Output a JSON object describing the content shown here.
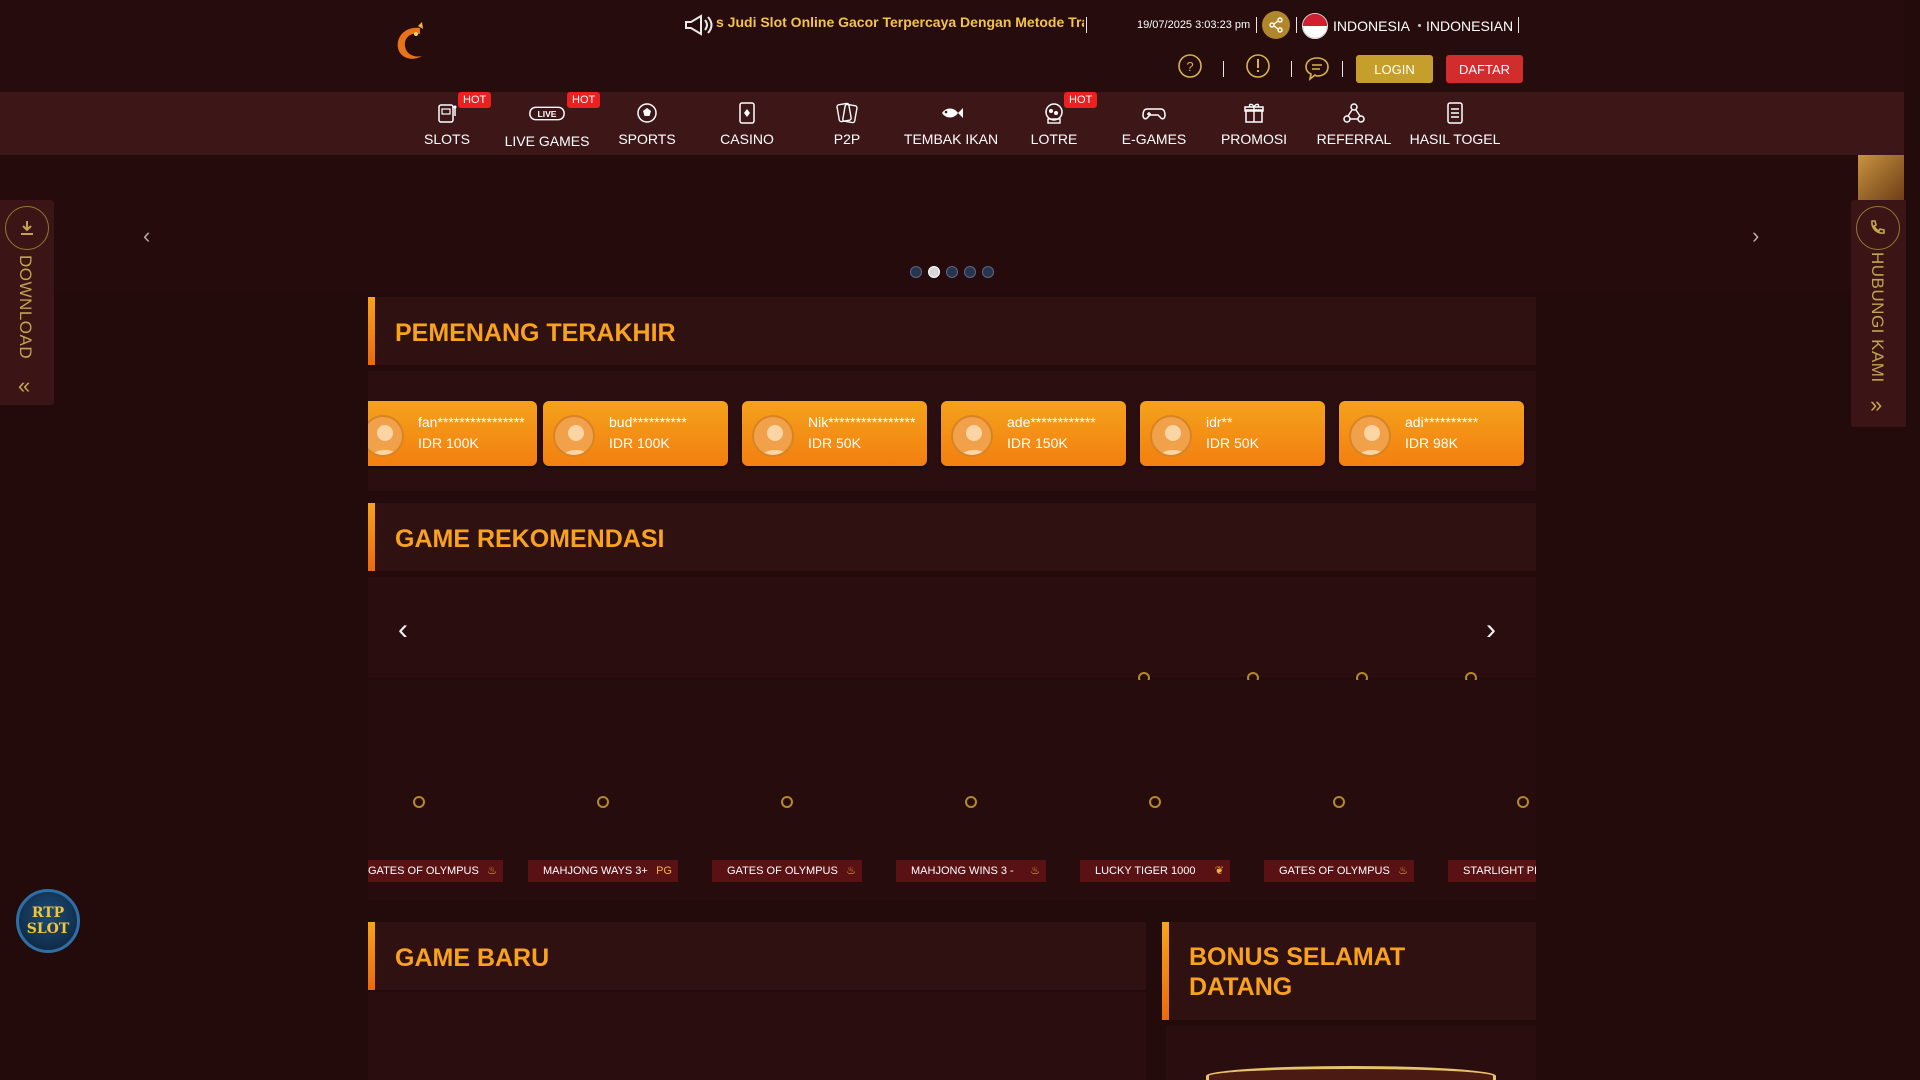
{
  "header": {
    "marquee_text": "s  Judi Slot Online Gacor Terpercaya Dengan Metode Transaksi",
    "datetime": "19/07/2025 3:03:23 pm",
    "country": "INDONESIA",
    "language": "INDONESIAN",
    "login_label": "LOGIN",
    "register_label": "DAFTAR",
    "colors": {
      "login": "#c59e2c",
      "register": "#d22c2c",
      "accent": "#f9a21e"
    }
  },
  "nav": {
    "items": [
      {
        "label": "SLOTS",
        "icon": "slot-machine-icon",
        "badge": "HOT"
      },
      {
        "label": "LIVE GAMES",
        "icon": "live-icon",
        "badge": "HOT"
      },
      {
        "label": "SPORTS",
        "icon": "soccer-ball-icon",
        "badge": ""
      },
      {
        "label": "CASINO",
        "icon": "card-icon",
        "badge": ""
      },
      {
        "label": "P2P",
        "icon": "cards-icon",
        "badge": ""
      },
      {
        "label": "TEMBAK IKAN",
        "icon": "fish-icon",
        "badge": ""
      },
      {
        "label": "LOTRE",
        "icon": "lottery-icon",
        "badge": "HOT"
      },
      {
        "label": "E-GAMES",
        "icon": "gamepad-icon",
        "badge": ""
      },
      {
        "label": "PROMOSI",
        "icon": "gift-icon",
        "badge": ""
      },
      {
        "label": "REFERRAL",
        "icon": "referral-icon",
        "badge": ""
      },
      {
        "label": "HASIL TOGEL",
        "icon": "document-icon",
        "badge": ""
      }
    ]
  },
  "banner": {
    "prev": "‹",
    "next": "›",
    "slide_count": 5,
    "active_slide": 2
  },
  "side": {
    "download_label": "DOWNLOAD",
    "download_chevron": "«",
    "contact_label": "HUBUNGI KAMI",
    "contact_chevron": "»",
    "rtp_line1": "RTP",
    "rtp_line2": "SLOT"
  },
  "winners": {
    "title": "PEMENANG TERAKHIR",
    "items": [
      {
        "name": "fan****************",
        "amount": "IDR 100K"
      },
      {
        "name": "bud**********",
        "amount": "IDR 100K"
      },
      {
        "name": "Nik****************",
        "amount": "IDR 50K"
      },
      {
        "name": "ade************",
        "amount": "IDR 150K"
      },
      {
        "name": "idr**",
        "amount": "IDR 50K"
      },
      {
        "name": "adi**********",
        "amount": "IDR 98K"
      }
    ]
  },
  "recommended": {
    "title": "GAME REKOMENDASI",
    "prev": "‹",
    "next": "›",
    "games": [
      {
        "name": "GATES OF OLYMPUS",
        "provider": "♨"
      },
      {
        "name": "MAHJONG WAYS 3+",
        "provider": "PG"
      },
      {
        "name": "GATES OF OLYMPUS",
        "provider": "♨"
      },
      {
        "name": "MAHJONG WINS 3 -",
        "provider": "♨"
      },
      {
        "name": "LUCKY TIGER 1000",
        "provider": "❦"
      },
      {
        "name": "GATES OF OLYMPUS",
        "provider": "♨"
      },
      {
        "name": "STARLIGHT PRINCESS",
        "provider": ""
      }
    ]
  },
  "new_games": {
    "title": "GAME BARU"
  },
  "bonus": {
    "title_line1": "BONUS SELAMAT",
    "title_line2": "DATANG"
  }
}
